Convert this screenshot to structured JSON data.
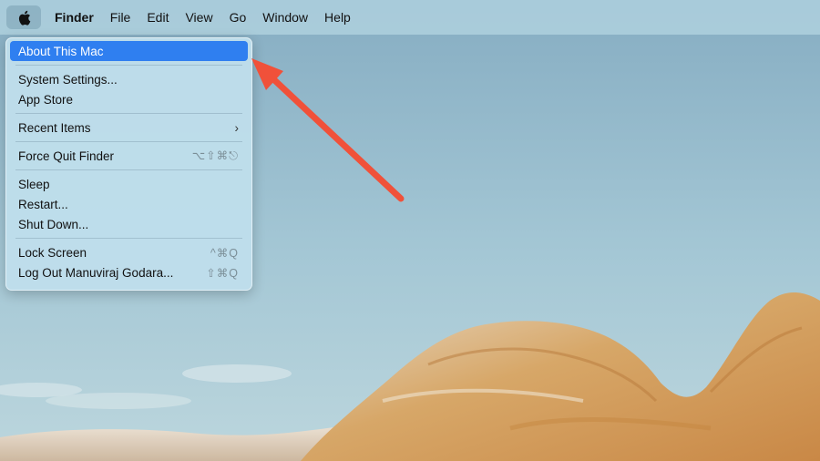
{
  "menubar": {
    "apple_icon": "apple-logo-icon",
    "items": [
      "Finder",
      "File",
      "Edit",
      "View",
      "Go",
      "Window",
      "Help"
    ]
  },
  "apple_menu": {
    "about": "About This Mac",
    "system_settings": "System Settings...",
    "app_store": "App Store",
    "recent_items": "Recent Items",
    "recent_items_chevron": "›",
    "force_quit": "Force Quit Finder",
    "force_quit_shortcut": "⌥⇧⌘⎋",
    "sleep": "Sleep",
    "restart": "Restart...",
    "shut_down": "Shut Down...",
    "lock_screen": "Lock Screen",
    "lock_screen_shortcut": "^⌘Q",
    "log_out": "Log Out Manuviraj Godara...",
    "log_out_shortcut": "⇧⌘Q"
  },
  "colors": {
    "highlight": "#2f7ff0",
    "annotation_arrow": "#f0513a"
  }
}
